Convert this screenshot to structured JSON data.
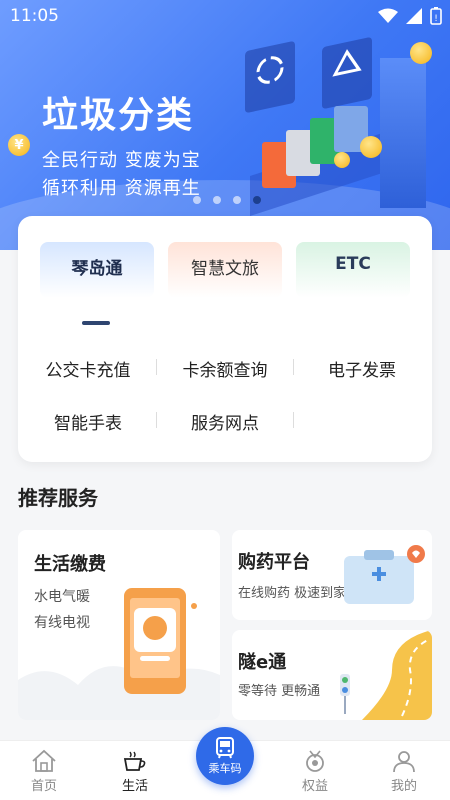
{
  "status_bar": {
    "time": "11:05"
  },
  "banner": {
    "title": "垃圾分类",
    "line1": "全民行动 变废为宝",
    "line2": "循环利用 资源再生",
    "coin_symbol": "¥",
    "dots": 4,
    "active_dot": 3
  },
  "tabs": [
    {
      "label": "琴岛通",
      "active": true
    },
    {
      "label": "智慧文旅",
      "active": false
    },
    {
      "label": "ETC",
      "active": false
    }
  ],
  "functions": [
    "公交卡充值",
    "卡余额查询",
    "电子发票",
    "智能手表",
    "服务网点"
  ],
  "recommend": {
    "title": "推荐服务",
    "life_pay": {
      "title": "生活缴费",
      "desc1": "水电气暖",
      "desc2": "有线电视"
    },
    "medicine": {
      "title": "购药平台",
      "desc": "在线购药 极速到家"
    },
    "tunnel": {
      "title": "隧e通",
      "desc": "零等待 更畅通"
    }
  },
  "nav": [
    {
      "label": "首页",
      "icon": "home-icon"
    },
    {
      "label": "生活",
      "icon": "coffee-cup-icon",
      "active": true
    },
    {
      "label": "乘车码",
      "icon": "bus-icon"
    },
    {
      "label": "权益",
      "icon": "medal-icon"
    },
    {
      "label": "我的",
      "icon": "user-icon"
    }
  ],
  "colors": {
    "primary": "#2f6ae8",
    "banner": "#3f78f5",
    "indicator": "#2e4570"
  }
}
